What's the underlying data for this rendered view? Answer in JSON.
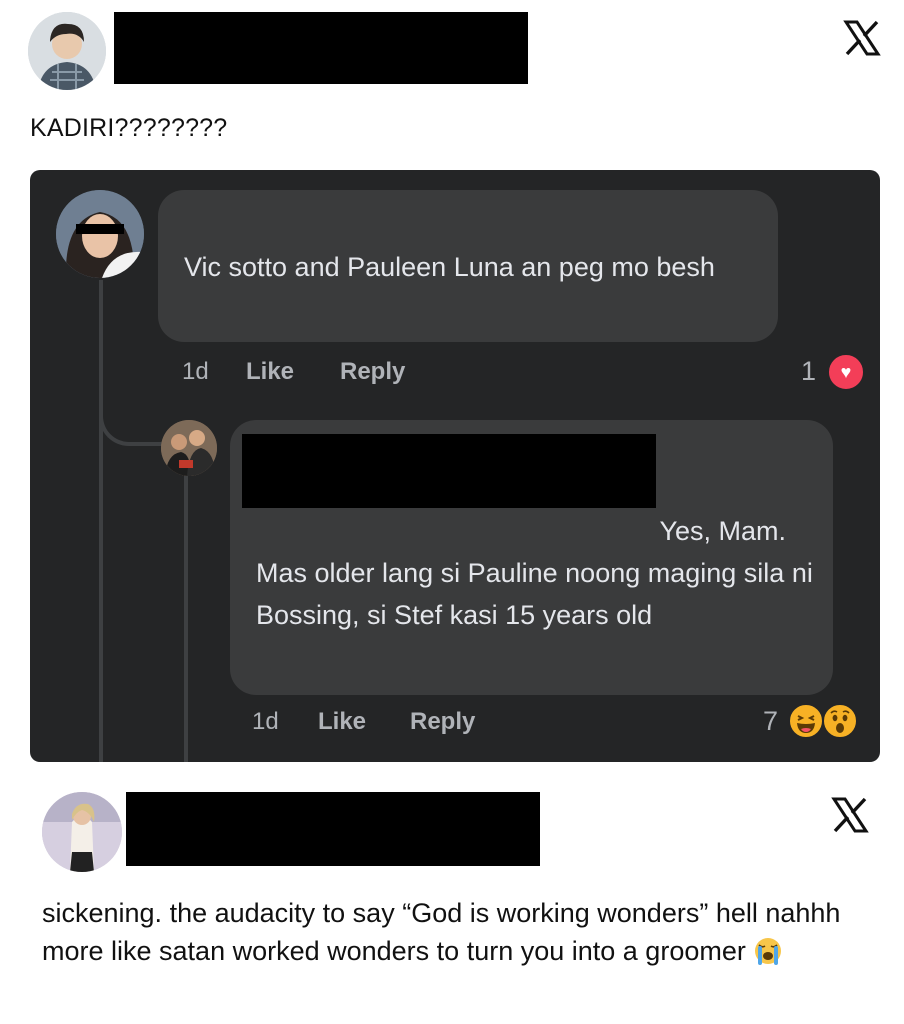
{
  "post_1": {
    "avatar_icon": "profile-photo",
    "username_redacted": true,
    "platform_icon": "x-logo-icon",
    "text": "KADIRI????????"
  },
  "screenshot": {
    "theme_colors": {
      "background": "#242526",
      "bubble": "#3a3b3c",
      "text": "#e4e6eb",
      "meta": "#b0b3b8"
    },
    "comment": {
      "avatar_icon": "profile-photo",
      "text": "Vic sotto and Pauleen Luna an peg mo besh",
      "time": "1d",
      "like_label": "Like",
      "reply_label": "Reply",
      "reaction_count": "1",
      "reactions": [
        "heart-reaction-icon"
      ]
    },
    "reply": {
      "avatar_icon": "profile-photo",
      "name_redacted": true,
      "first_line": "Yes, Mam.",
      "text": "Mas older lang si Pauline noong maging sila ni Bossing, si Stef kasi 15 years old",
      "time": "1d",
      "like_label": "Like",
      "reply_label": "Reply",
      "reaction_count": "7",
      "reactions": [
        "haha-reaction-icon",
        "wow-reaction-icon"
      ]
    }
  },
  "post_2": {
    "avatar_icon": "profile-photo",
    "username_redacted": true,
    "platform_icon": "x-logo-icon",
    "text": "sickening. the audacity to say “God is working wonders” hell nahhh more like satan worked wonders to turn you into a groomer",
    "trailing_emoji": "loudly-crying-face-icon"
  }
}
